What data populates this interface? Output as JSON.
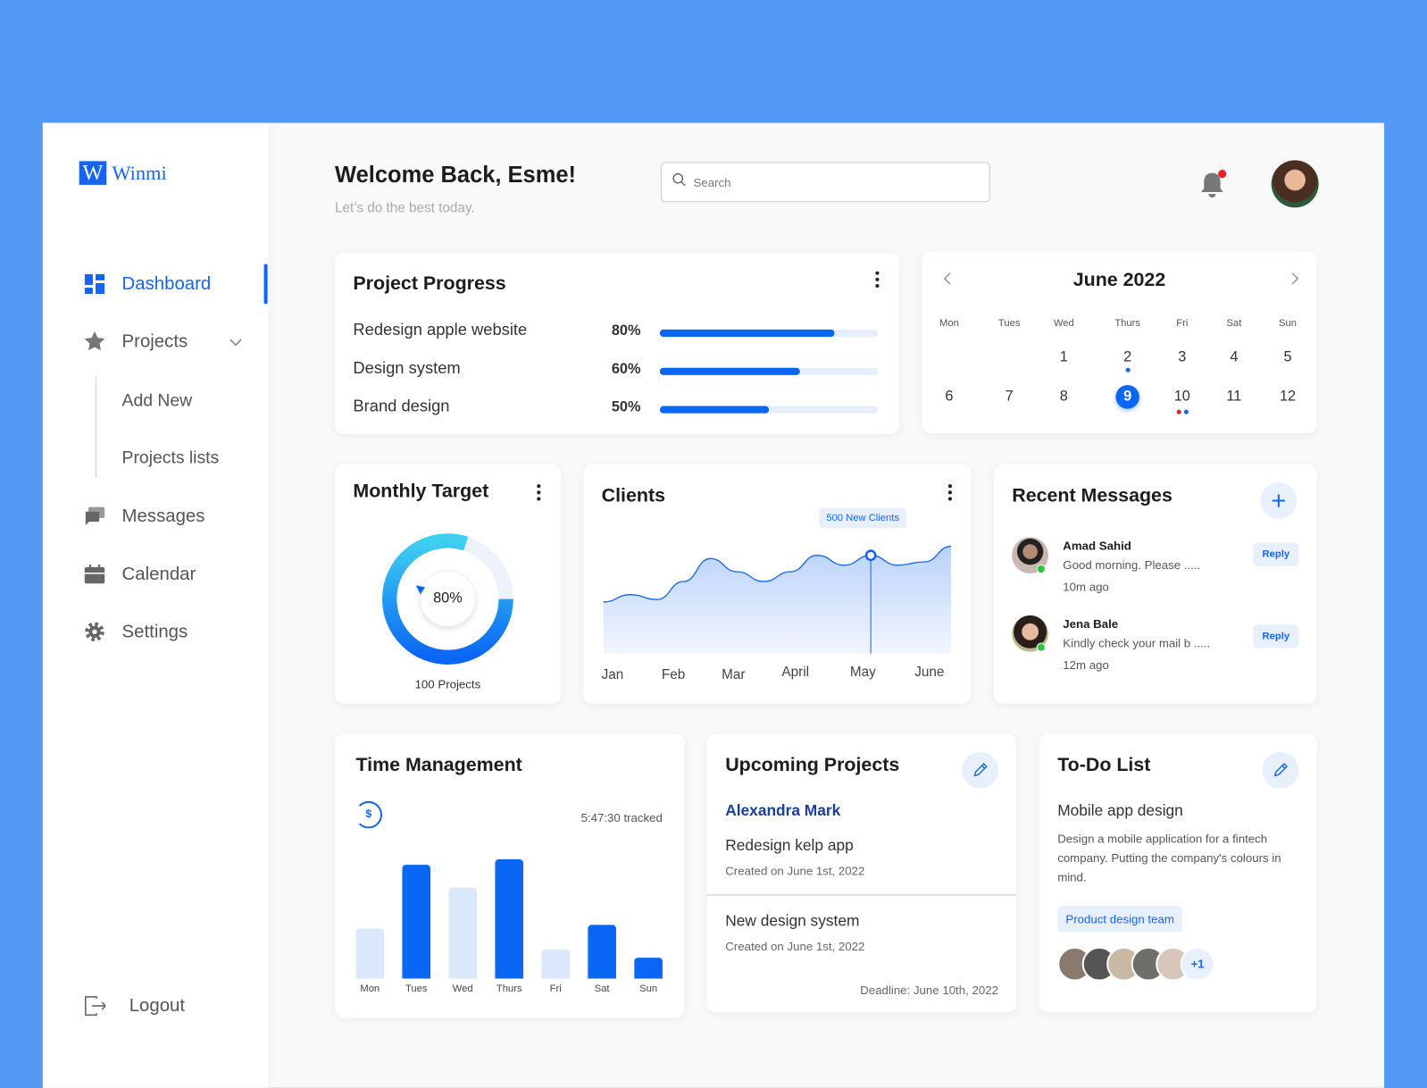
{
  "brand": {
    "logo_letter": "W",
    "name": "Winmi",
    "accent": "#1465f5"
  },
  "sidebar": {
    "items": [
      {
        "label": "Dashboard",
        "icon": "grid-icon",
        "active": true
      },
      {
        "label": "Projects",
        "icon": "star-icon"
      },
      {
        "label": "Messages",
        "icon": "chat-icon"
      },
      {
        "label": "Calendar",
        "icon": "calendar-icon"
      },
      {
        "label": "Settings",
        "icon": "gear-icon"
      }
    ],
    "sub_items": [
      "Add New",
      "Projects lists"
    ],
    "logout": "Logout"
  },
  "header": {
    "title": "Welcome Back, Esme!",
    "subtitle": "Let’s do the best today.",
    "search_placeholder": "Search"
  },
  "progress": {
    "title": "Project Progress",
    "items": [
      {
        "name": "Redesign apple website",
        "label": "80%",
        "value": 0.8
      },
      {
        "name": "Design system",
        "label": "60%",
        "value": 0.64
      },
      {
        "name": "Brand design",
        "label": "50%",
        "value": 0.5
      }
    ]
  },
  "calendar": {
    "month": "June 2022",
    "weekdays": [
      "Mon",
      "Tues",
      "Wed",
      "Thurs",
      "Fri",
      "Sat",
      "Sun"
    ],
    "weeks": [
      [
        "",
        "",
        "1",
        "2",
        "3",
        "4",
        "5"
      ],
      [
        "6",
        "7",
        "8",
        "9",
        "10",
        "11",
        "12"
      ]
    ],
    "selected": "9"
  },
  "target": {
    "title": "Monthly Target",
    "percent": "80%",
    "value": 0.8,
    "caption": "100 Projects"
  },
  "clients": {
    "title": "Clients",
    "tooltip": "500 New Clients",
    "months": [
      "Jan",
      "Feb",
      "Mar",
      "April",
      "May",
      "June"
    ],
    "values": [
      63,
      72,
      66,
      88,
      116,
      100,
      88,
      100,
      120,
      108,
      120,
      108,
      112,
      131
    ]
  },
  "messages": {
    "title": "Recent Messages",
    "reply": "Reply",
    "items": [
      {
        "name": "Amad Sahid",
        "text": "Good morning. Please .....",
        "time": "10m ago"
      },
      {
        "name": "Jena Bale",
        "text": "Kindly check your mail b .....",
        "time": "12m ago"
      }
    ]
  },
  "time": {
    "title": "Time Management",
    "tracked": "5:47:30 tracked",
    "currency": "$",
    "days": [
      "Mon",
      "Tues",
      "Wed",
      "Thurs",
      "Fri",
      "Sat",
      "Sun"
    ],
    "values": [
      55,
      125,
      100,
      131,
      32,
      59,
      23
    ],
    "highlight": [
      false,
      true,
      false,
      true,
      false,
      true,
      true
    ]
  },
  "upcoming": {
    "title": "Upcoming Projects",
    "person": "Alexandra Mark",
    "projects": [
      {
        "name": "Redesign kelp app",
        "created": "Created on June 1st, 2022"
      },
      {
        "name": "New design system",
        "created": "Created on June 1st, 2022"
      }
    ],
    "deadline": "Deadline: June 10th, 2022"
  },
  "todo": {
    "title": "To-Do List",
    "task": "Mobile app design",
    "desc": "Design a mobile application for a fintech company.  Putting the company's colours in mind.",
    "tag": "Product design team",
    "more": "+1"
  }
}
